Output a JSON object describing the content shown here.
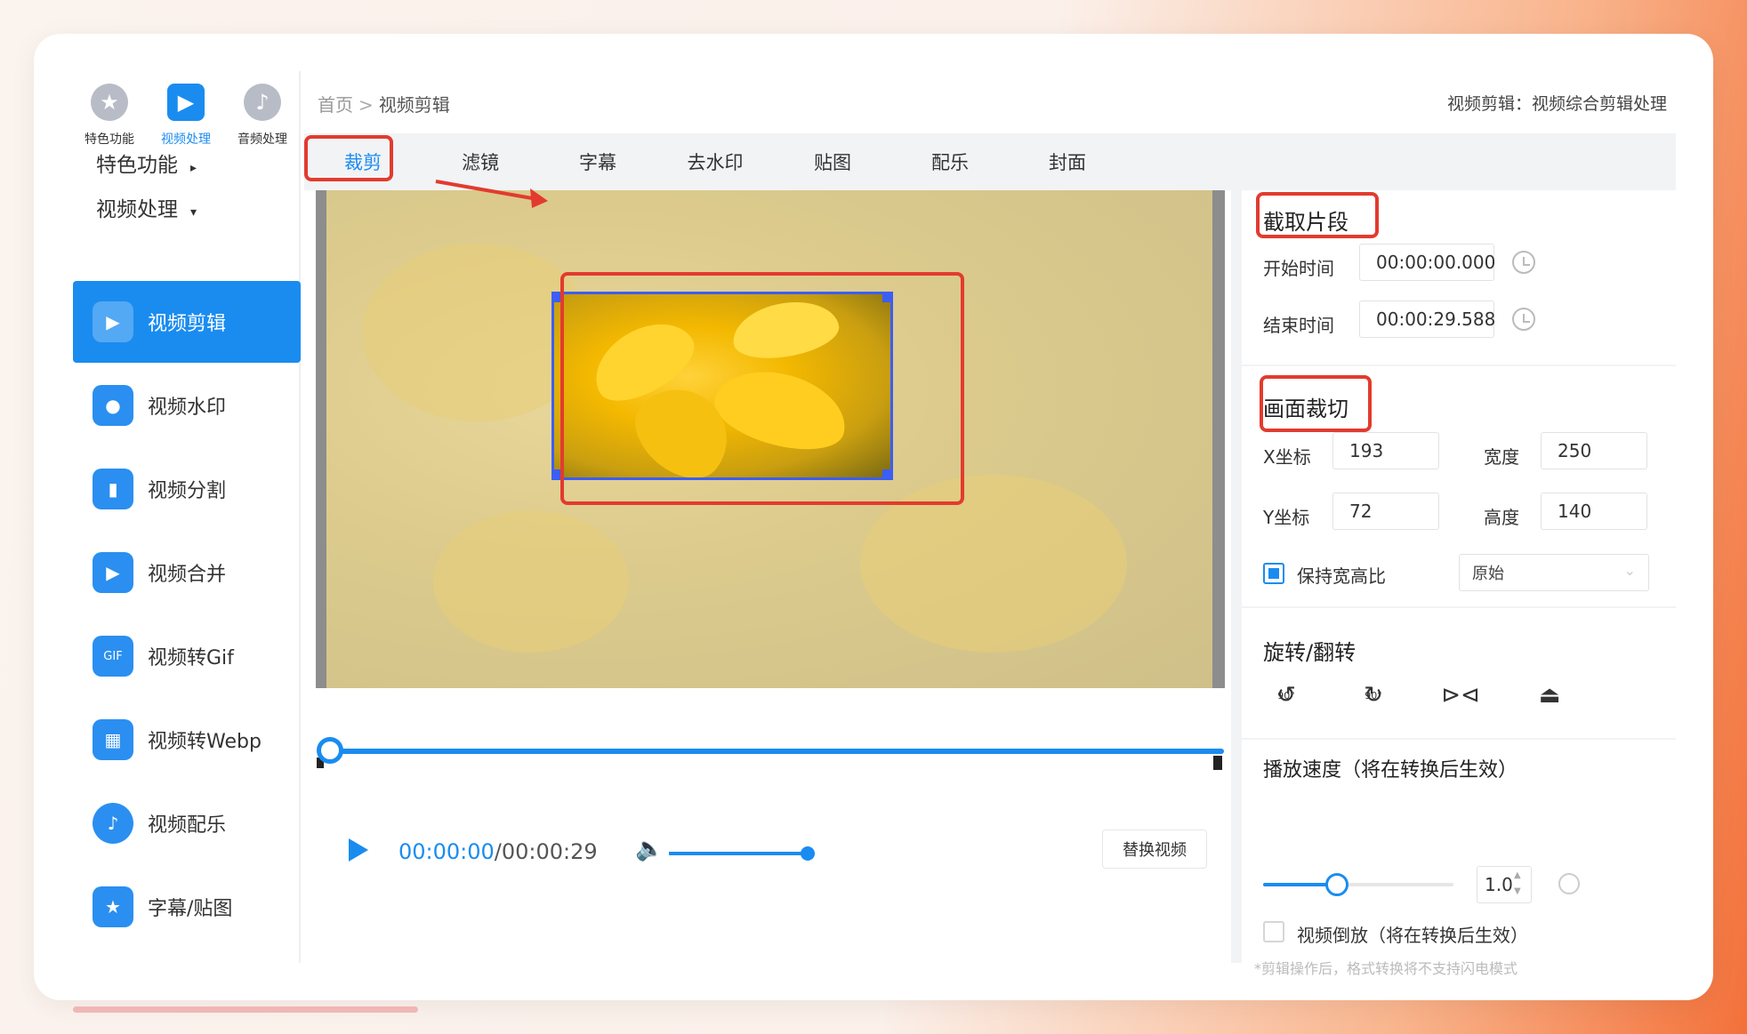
{
  "sidebar": {
    "top_icons": [
      {
        "label": "特色功能",
        "icon": "star-icon"
      },
      {
        "label": "视频处理",
        "icon": "film-icon"
      },
      {
        "label": "音频处理",
        "icon": "music-icon"
      }
    ],
    "sections": [
      {
        "label": "特色功能",
        "caret": "▸"
      },
      {
        "label": "视频处理",
        "caret": "▾"
      }
    ],
    "items": [
      {
        "label": "视频剪辑",
        "icon": "video-edit-icon",
        "glyph": "▶"
      },
      {
        "label": "视频水印",
        "icon": "watermark-icon",
        "glyph": "●"
      },
      {
        "label": "视频分割",
        "icon": "split-icon",
        "glyph": "▮"
      },
      {
        "label": "视频合并",
        "icon": "merge-icon",
        "glyph": "▶"
      },
      {
        "label": "视频转Gif",
        "icon": "gif-icon",
        "glyph": "GIF"
      },
      {
        "label": "视频转Webp",
        "icon": "webp-icon",
        "glyph": "▦"
      },
      {
        "label": "视频配乐",
        "icon": "music-video-icon",
        "glyph": "♪"
      },
      {
        "label": "字幕/贴图",
        "icon": "sticker-icon",
        "glyph": "★"
      }
    ]
  },
  "header": {
    "breadcrumb_home": "首页",
    "breadcrumb_sep": ">",
    "breadcrumb_current": "视频剪辑",
    "description": "视频剪辑：视频综合剪辑处理"
  },
  "tabs": [
    "裁剪",
    "滤镜",
    "字幕",
    "去水印",
    "贴图",
    "配乐",
    "封面"
  ],
  "player": {
    "current_time": "00:00:00",
    "total_time": "/00:00:29",
    "replace_button": "替换视频"
  },
  "right": {
    "clip_title": "截取片段",
    "start_label": "开始时间",
    "start_value": "00:00:00.000",
    "end_label": "结束时间",
    "end_value": "00:00:29.588",
    "crop_title": "画面裁切",
    "x_label": "X坐标",
    "x_value": "193",
    "width_label": "宽度",
    "width_value": "250",
    "y_label": "Y坐标",
    "y_value": "72",
    "height_label": "高度",
    "height_value": "140",
    "keep_ratio_label": "保持宽高比",
    "ratio_select": "原始",
    "rotate_title": "旋转/翻转",
    "speed_title": "播放速度（将在转换后生效）",
    "speed_value": "1.0",
    "reverse_label": "视频倒放（将在转换后生效）",
    "note": "*剪辑操作后，格式转换将不支持闪电模式"
  },
  "colors": {
    "accent": "#1a8cf0",
    "highlight_red": "#e23b2e",
    "crop_border": "#3c5ef5"
  }
}
